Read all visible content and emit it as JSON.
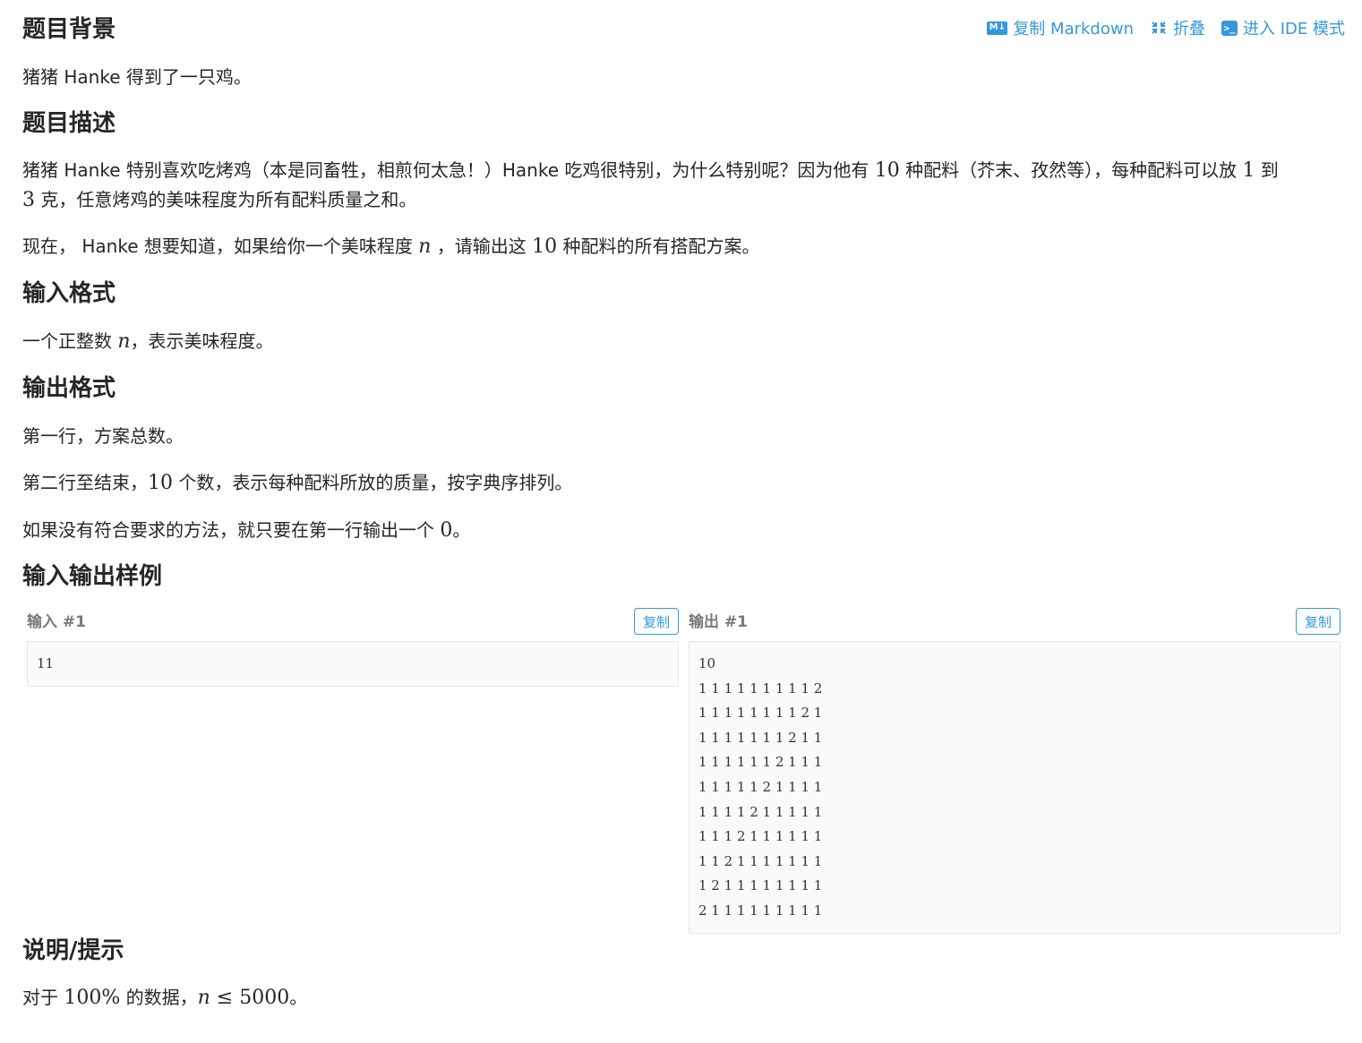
{
  "toolbar": {
    "copy_markdown": "复制 Markdown",
    "fold": "折叠",
    "ide_mode": "进入 IDE 模式",
    "md_icon_text": "M↓",
    "ide_icon_text": ">_"
  },
  "sections": {
    "background": {
      "title": "题目背景",
      "text": "猪猪 Hanke 得到了一只鸡。"
    },
    "description": {
      "title": "题目描述",
      "p1_a": "猪猪 Hanke 特别喜欢吃烤鸡（本是同畜牲，相煎何太急！）Hanke 吃鸡很特别，为什么特别呢？因为他有 ",
      "p1_num10": "10",
      "p1_b": " 种配料（芥末、孜然等），每种配料可以放 ",
      "p1_num1": "1",
      "p1_c": " 到",
      "p1_num3": "3",
      "p1_d": " 克，任意烤鸡的美味程度为所有配料质量之和。",
      "p2_a": "现在， Hanke 想要知道，如果给你一个美味程度 ",
      "p2_n": "n",
      "p2_b": " ，请输出这 ",
      "p2_num10": "10",
      "p2_c": " 种配料的所有搭配方案。"
    },
    "input_format": {
      "title": "输入格式",
      "a": "一个正整数 ",
      "n": "n",
      "b": "，表示美味程度。"
    },
    "output_format": {
      "title": "输出格式",
      "line1": "第一行，方案总数。",
      "line2_a": "第二行至结束，",
      "line2_num": "10",
      "line2_b": " 个数，表示每种配料所放的质量，按字典序排列。",
      "line3_a": "如果没有符合要求的方法，就只要在第一行输出一个 ",
      "line3_num": "0",
      "line3_b": "。"
    },
    "samples": {
      "title": "输入输出样例",
      "input_title": "输入 #1",
      "output_title": "输出 #1",
      "copy_label": "复制",
      "input_text": "11",
      "output_text": "10\n1 1 1 1 1 1 1 1 1 2\n1 1 1 1 1 1 1 1 2 1\n1 1 1 1 1 1 1 2 1 1\n1 1 1 1 1 1 2 1 1 1\n1 1 1 1 1 2 1 1 1 1\n1 1 1 1 2 1 1 1 1 1\n1 1 1 2 1 1 1 1 1 1\n1 1 2 1 1 1 1 1 1 1\n1 2 1 1 1 1 1 1 1 1\n2 1 1 1 1 1 1 1 1 1"
    },
    "hint": {
      "title": "说明/提示",
      "a": "对于 ",
      "pct": "100%",
      "b": " 的数据，",
      "n": "n",
      "le": " ≤ ",
      "max": "5000",
      "c": "。"
    }
  },
  "colors": {
    "accent": "#3498db",
    "text": "#262626",
    "sample_bg": "#fafafa"
  }
}
